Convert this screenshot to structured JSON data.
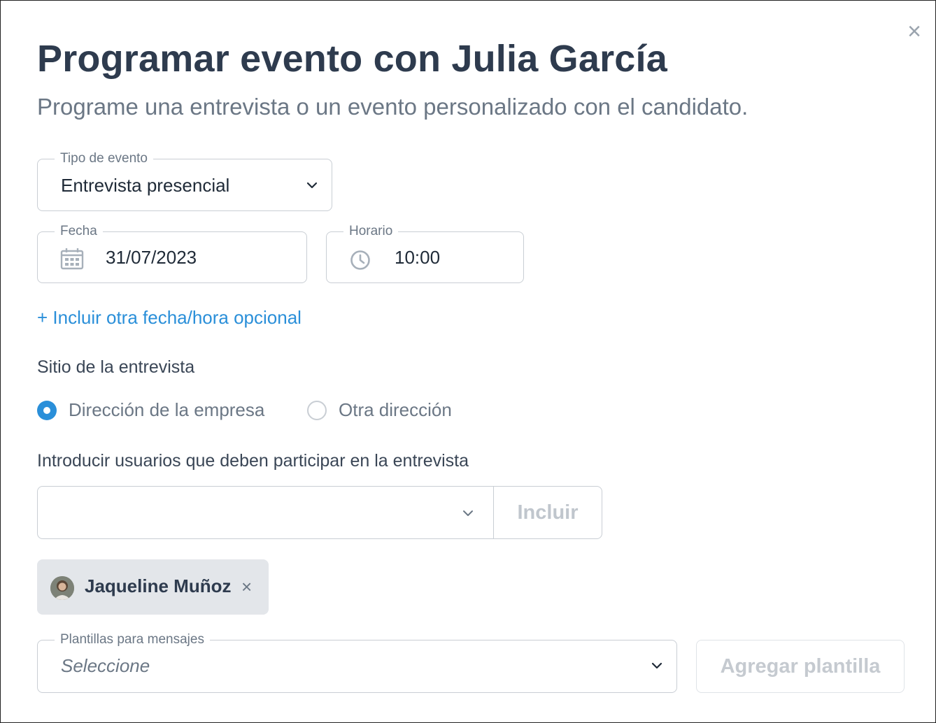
{
  "header": {
    "title": "Programar evento con Julia García",
    "subtitle": "Programe una entrevista o un evento personalizado con el candidato.",
    "close_icon": "close-icon"
  },
  "event_type": {
    "label": "Tipo de evento",
    "value": "Entrevista presencial"
  },
  "date": {
    "label": "Fecha",
    "value": "31/07/2023",
    "icon": "calendar-icon"
  },
  "time": {
    "label": "Horario",
    "value": "10:00",
    "icon": "clock-icon"
  },
  "add_optional_datetime_link": "+ Incluir otra fecha/hora opcional",
  "location": {
    "label": "Sitio de la entrevista",
    "options": [
      {
        "label": "Dirección de la empresa",
        "selected": true
      },
      {
        "label": "Otra dirección",
        "selected": false
      }
    ]
  },
  "participants": {
    "label": "Introducir usuarios que deben participar en la entrevista",
    "select_value": "",
    "include_button": "Incluir",
    "selected_users": [
      {
        "name": "Jaqueline Muñoz"
      }
    ]
  },
  "templates": {
    "label": "Plantillas para mensajes",
    "placeholder": "Seleccione",
    "add_button": "Agregar plantilla"
  },
  "colors": {
    "accent": "#2a8fd9",
    "title": "#2e3b4e",
    "muted": "#6b7785",
    "border": "#c9ced4",
    "chip_bg": "#e3e6ea"
  }
}
